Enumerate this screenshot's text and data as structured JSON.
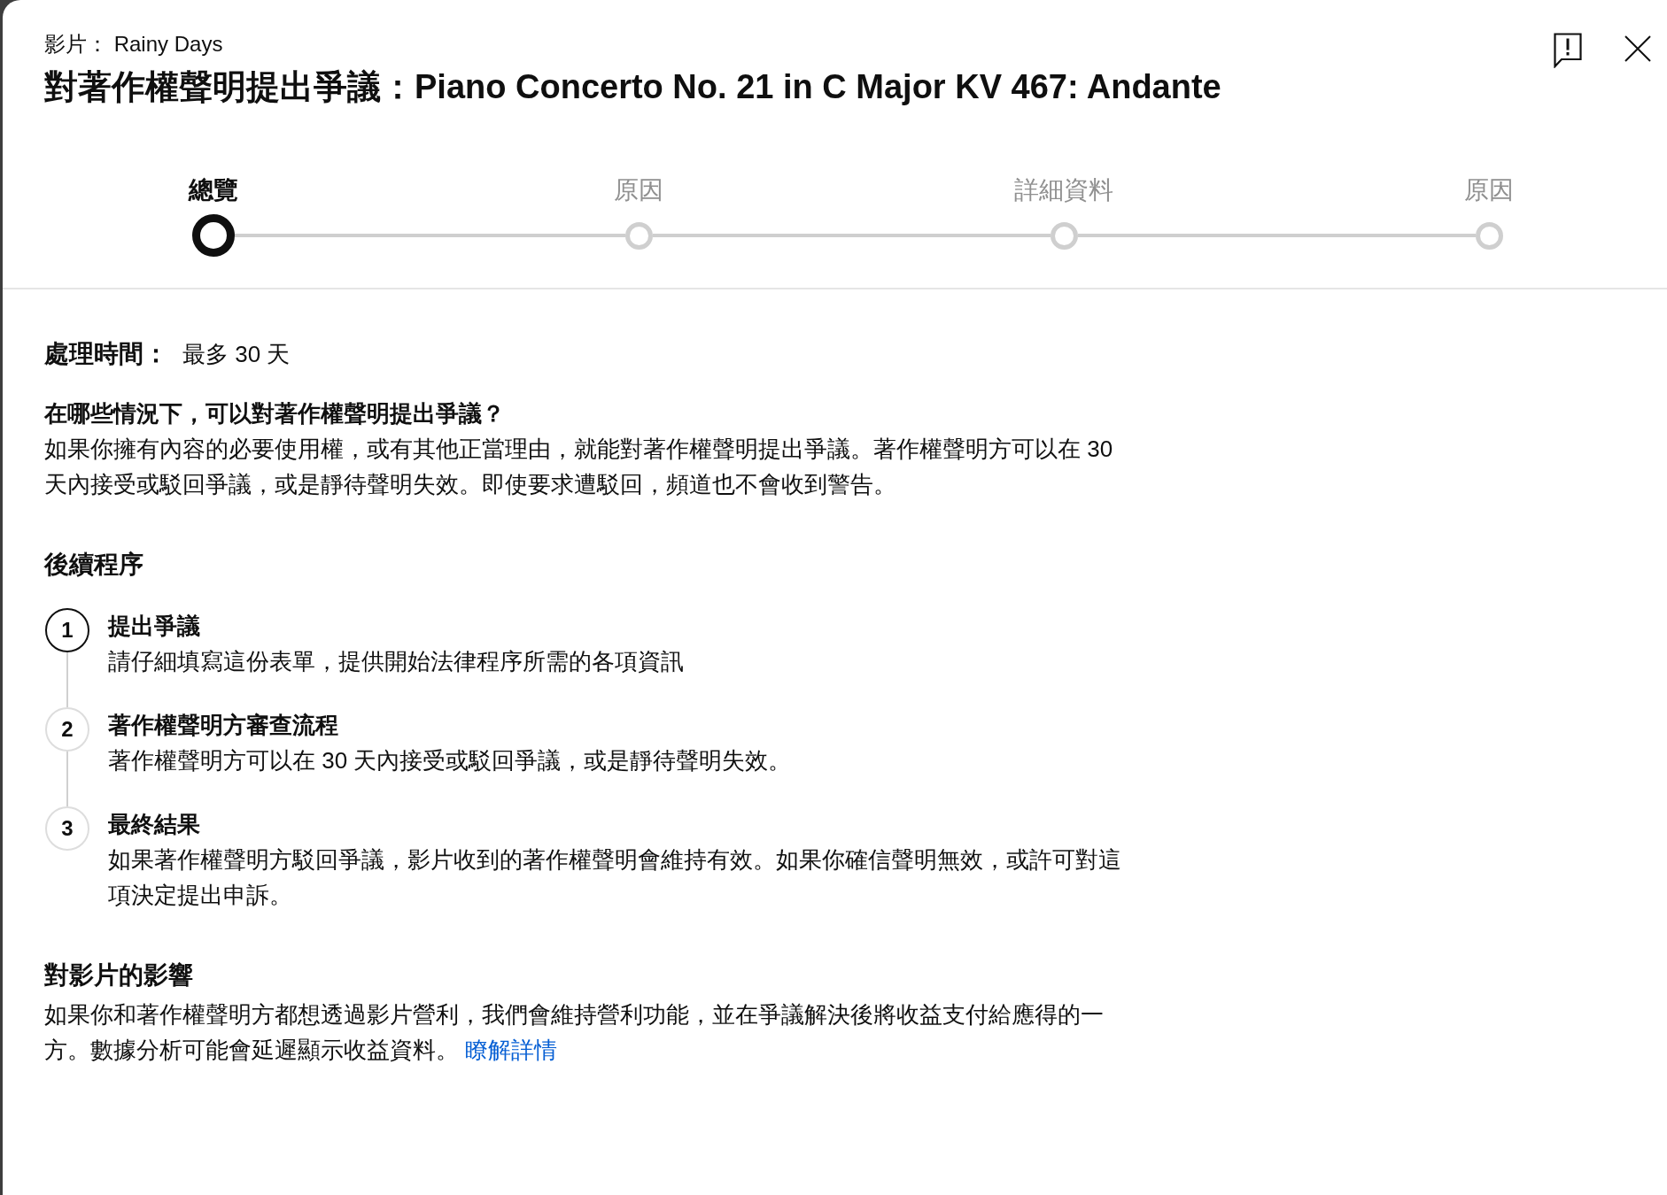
{
  "dialog": {
    "video_label": "影片： Rainy Days",
    "title": "對著作權聲明提出爭議：Piano Concerto No. 21 in C Major KV 467: Andante"
  },
  "stepper": [
    {
      "label": "總覽",
      "selected": true
    },
    {
      "label": "原因",
      "selected": false
    },
    {
      "label": "詳細資料",
      "selected": false
    },
    {
      "label": "原因",
      "selected": false
    }
  ],
  "processing_time": {
    "label": "處理時間：",
    "value": "最多 30 天"
  },
  "eligibility": {
    "heading": "在哪些情況下，可以對著作權聲明提出爭議？",
    "text": "如果你擁有內容的必要使用權，或有其他正當理由，就能對著作權聲明提出爭議。著作權聲明方可以在 30 天內接受或駁回爭議，或是靜待聲明失效。即使要求遭駁回，頻道也不會收到警告。"
  },
  "next_steps": {
    "heading": "後續程序",
    "steps": [
      {
        "number": "1",
        "title": "提出爭議",
        "text": "請仔細填寫這份表單，提供開始法律程序所需的各項資訊",
        "active": true
      },
      {
        "number": "2",
        "title": "著作權聲明方審查流程",
        "text": "著作權聲明方可以在 30 天內接受或駁回爭議，或是靜待聲明失效。",
        "active": false
      },
      {
        "number": "3",
        "title": "最終結果",
        "text": "如果著作權聲明方駁回爭議，影片收到的著作權聲明會維持有效。如果你確信聲明無效，或許可對這項決定提出申訴。",
        "active": false
      }
    ]
  },
  "impact": {
    "heading": "對影片的影響",
    "text": "如果你和著作權聲明方都想透過影片營利，我們會維持營利功能，並在爭議解決後將收益支付給應得的一方。數據分析可能會延遲顯示收益資料。",
    "link": "瞭解詳情"
  }
}
